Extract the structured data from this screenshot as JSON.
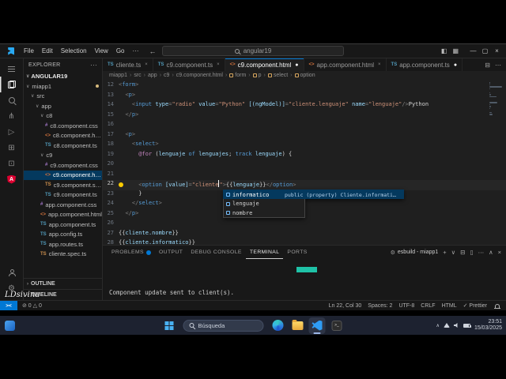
{
  "watermark": "LDsivina",
  "titlebar": {
    "menus": [
      "File",
      "Edit",
      "Selection",
      "View",
      "Go"
    ],
    "menu_overflow": "···",
    "back": "←",
    "forward": "→",
    "command_center": "angular19",
    "window_controls": {
      "minimize": "—",
      "maximize": "▢",
      "close": "×"
    }
  },
  "activity_bar": {
    "top": [
      {
        "name": "menu-icon"
      },
      {
        "name": "explorer-icon",
        "active": true
      },
      {
        "name": "search-icon"
      },
      {
        "name": "source-control-icon"
      },
      {
        "name": "run-debug-icon"
      },
      {
        "name": "extensions-icon"
      },
      {
        "name": "remote-explorer-icon"
      },
      {
        "name": "angular-icon"
      }
    ],
    "bottom": [
      {
        "name": "account-icon"
      },
      {
        "name": "settings-gear-icon"
      }
    ]
  },
  "explorer": {
    "title": "EXPLORER",
    "title_actions": "···",
    "section": "ANGULAR19",
    "tree": [
      {
        "label": "miapp1",
        "kind": "folder",
        "depth": 0,
        "badge": true
      },
      {
        "label": "src",
        "kind": "folder",
        "depth": 1
      },
      {
        "label": "app",
        "kind": "folder",
        "depth": 2
      },
      {
        "label": "c8",
        "kind": "folder",
        "depth": 3
      },
      {
        "label": "c8.component.css",
        "kind": "css",
        "depth": 4
      },
      {
        "label": "c8.component.html",
        "kind": "html",
        "depth": 4
      },
      {
        "label": "c8.component.ts",
        "kind": "ts",
        "depth": 4
      },
      {
        "label": "c9",
        "kind": "folder",
        "depth": 3
      },
      {
        "label": "c9.component.css",
        "kind": "css",
        "depth": 4
      },
      {
        "label": "c9.component.html",
        "kind": "html",
        "depth": 4,
        "selected": true
      },
      {
        "label": "c9.component.spec.ts",
        "kind": "ts-spec",
        "depth": 4
      },
      {
        "label": "c9.component.ts",
        "kind": "ts",
        "depth": 4
      },
      {
        "label": "app.component.css",
        "kind": "css",
        "depth": 3
      },
      {
        "label": "app.component.html",
        "kind": "html",
        "depth": 3
      },
      {
        "label": "app.component.ts",
        "kind": "ts",
        "depth": 3
      },
      {
        "label": "app.config.ts",
        "kind": "ts",
        "depth": 3
      },
      {
        "label": "app.routes.ts",
        "kind": "ts",
        "depth": 3
      },
      {
        "label": "cliente.spec.ts",
        "kind": "ts-spec",
        "depth": 3
      }
    ],
    "bottom_sections": [
      "OUTLINE",
      "TIMELINE"
    ]
  },
  "tabs": {
    "items": [
      {
        "label": "cliente.ts",
        "icon": "ts",
        "state": "close"
      },
      {
        "label": "c9.component.ts",
        "icon": "ts",
        "state": "close"
      },
      {
        "label": "c9.component.html",
        "icon": "html",
        "active": true,
        "state": "modified"
      },
      {
        "label": "app.component.html",
        "icon": "html",
        "state": "close"
      },
      {
        "label": "app.component.ts",
        "icon": "ts",
        "state": "modified"
      }
    ],
    "actions": [
      "split-editor",
      "more"
    ]
  },
  "breadcrumbs": [
    {
      "label": "miapp1"
    },
    {
      "label": "src"
    },
    {
      "label": "app"
    },
    {
      "label": "c9"
    },
    {
      "label": "c9.component.html"
    },
    {
      "label": "form",
      "symbol": true
    },
    {
      "label": "p",
      "symbol": true
    },
    {
      "label": "select",
      "symbol": true
    },
    {
      "label": "option",
      "symbol": true
    }
  ],
  "editor": {
    "active_line": 22,
    "lightbulb_line": 22,
    "lines": [
      {
        "n": 12,
        "tk": [
          [
            "p",
            "<"
          ],
          [
            "tag",
            "form"
          ],
          [
            "p",
            ">"
          ]
        ]
      },
      {
        "n": 13,
        "tk": [
          [
            "w",
            "  "
          ],
          [
            "p",
            "<"
          ],
          [
            "tag",
            "p"
          ],
          [
            "p",
            ">"
          ]
        ]
      },
      {
        "n": 14,
        "tk": [
          [
            "w",
            "    "
          ],
          [
            "p",
            "<"
          ],
          [
            "tag",
            "input"
          ],
          [
            "txt",
            " "
          ],
          [
            "attr",
            "type"
          ],
          [
            "p",
            "="
          ],
          [
            "str",
            "\"radio\""
          ],
          [
            "txt",
            " "
          ],
          [
            "attr",
            "value"
          ],
          [
            "p",
            "="
          ],
          [
            "str",
            "\"Python\""
          ],
          [
            "txt",
            " "
          ],
          [
            "attr",
            "[(ngModel)]"
          ],
          [
            "p",
            "="
          ],
          [
            "str",
            "\"cliente.lenguaje\""
          ],
          [
            "txt",
            " "
          ],
          [
            "attr",
            "name"
          ],
          [
            "p",
            "="
          ],
          [
            "str",
            "\"lenguaje\""
          ],
          [
            "p",
            "/>"
          ],
          [
            "txt",
            "Python"
          ]
        ]
      },
      {
        "n": 15,
        "tk": [
          [
            "w",
            "  "
          ],
          [
            "p",
            "</"
          ],
          [
            "tag",
            "p"
          ],
          [
            "p",
            ">"
          ]
        ]
      },
      {
        "n": 16,
        "tk": []
      },
      {
        "n": 17,
        "tk": [
          [
            "w",
            "  "
          ],
          [
            "p",
            "<"
          ],
          [
            "tag",
            "p"
          ],
          [
            "p",
            ">"
          ]
        ]
      },
      {
        "n": 18,
        "tk": [
          [
            "w",
            "    "
          ],
          [
            "p",
            "<"
          ],
          [
            "tag",
            "select"
          ],
          [
            "p",
            ">"
          ]
        ]
      },
      {
        "n": 19,
        "tk": [
          [
            "w",
            "      "
          ],
          [
            "kw",
            "@for"
          ],
          [
            "txt",
            " ("
          ],
          [
            "attr",
            "lenguaje"
          ],
          [
            "txt",
            " "
          ],
          [
            "kw2",
            "of"
          ],
          [
            "txt",
            " "
          ],
          [
            "attr",
            "lenguajes"
          ],
          [
            "txt",
            "; "
          ],
          [
            "kw2",
            "track"
          ],
          [
            "txt",
            " "
          ],
          [
            "attr",
            "lenguaje"
          ],
          [
            "txt",
            ") {"
          ]
        ]
      },
      {
        "n": 20,
        "tk": []
      },
      {
        "n": 21,
        "tk": []
      },
      {
        "n": 22,
        "tk": [
          [
            "w",
            "      "
          ],
          [
            "p",
            "<"
          ],
          [
            "tag",
            "option"
          ],
          [
            "txt",
            " "
          ],
          [
            "attr",
            "[value]"
          ],
          [
            "p",
            "="
          ],
          [
            "str",
            "\"cliente"
          ],
          [
            "cur",
            ""
          ],
          [
            "str",
            "\""
          ],
          [
            "p",
            ">"
          ],
          [
            "txt",
            "{{"
          ],
          [
            "attr",
            "lenguaje"
          ],
          [
            "txt",
            "}}"
          ],
          [
            "p",
            "</"
          ],
          [
            "tag",
            "option"
          ],
          [
            "p",
            ">"
          ]
        ]
      },
      {
        "n": 23,
        "tk": [
          [
            "w",
            "      "
          ],
          [
            "txt",
            "}"
          ]
        ]
      },
      {
        "n": 24,
        "tk": [
          [
            "w",
            "    "
          ],
          [
            "p",
            "</"
          ],
          [
            "tag",
            "select"
          ],
          [
            "p",
            ">"
          ]
        ]
      },
      {
        "n": 25,
        "tk": [
          [
            "w",
            "  "
          ],
          [
            "p",
            "</"
          ],
          [
            "tag",
            "p"
          ],
          [
            "p",
            ">"
          ]
        ]
      },
      {
        "n": 26,
        "tk": []
      },
      {
        "n": 27,
        "tk": [
          [
            "txt",
            "{{"
          ],
          [
            "attr",
            "cliente.nombre"
          ],
          [
            "txt",
            "}}"
          ]
        ]
      },
      {
        "n": 28,
        "tk": [
          [
            "txt",
            "{{"
          ],
          [
            "attr",
            "cliente.informatico"
          ],
          [
            "txt",
            "}}"
          ]
        ]
      }
    ]
  },
  "suggest": {
    "items": [
      {
        "label": "informatico",
        "selected": true,
        "detail": "public (property) Cliente.informatico: bo..."
      },
      {
        "label": "lenguaje"
      },
      {
        "label": "nombre"
      }
    ]
  },
  "panel": {
    "tabs": [
      {
        "label": "PROBLEMS",
        "badge": true
      },
      {
        "label": "OUTPUT"
      },
      {
        "label": "DEBUG CONSOLE"
      },
      {
        "label": "TERMINAL",
        "active": true
      },
      {
        "label": "PORTS"
      }
    ],
    "terminal_process": "esbuild - miapp1",
    "terminal_text": "Component update sent to client(s).",
    "actions": [
      "plus",
      "chevron-down",
      "split",
      "trash",
      "more",
      "chevron-up",
      "close"
    ]
  },
  "status_bar": {
    "remote_glyph": "><",
    "problems": "⊘ 0  △ 0",
    "right": [
      "Ln 22, Col 30",
      "Spaces: 2",
      "UTF-8",
      "CRLF",
      "HTML",
      "✓ Prettier"
    ]
  },
  "taskbar": {
    "search": "Búsqueda",
    "apps": [
      {
        "name": "edge"
      },
      {
        "name": "file-explorer"
      },
      {
        "name": "vscode",
        "active": true
      },
      {
        "name": "terminal"
      }
    ],
    "tray_time": "23:51",
    "tray_date": "15/03/2025"
  }
}
